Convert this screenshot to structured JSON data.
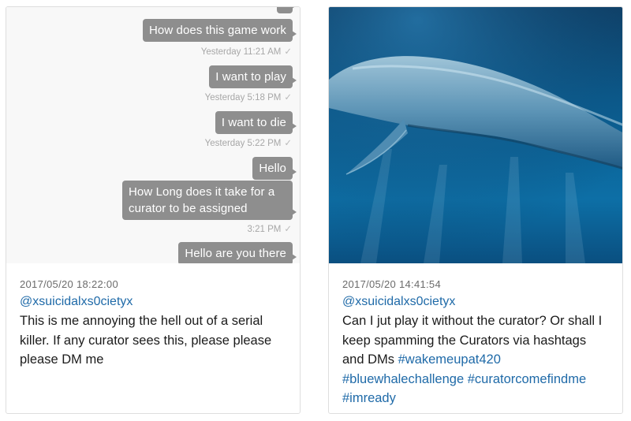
{
  "left_post": {
    "chat": {
      "messages": [
        {
          "text": "How does this game work",
          "time": "Yesterday 11:21 AM"
        },
        {
          "text": "I want to play",
          "time": "Yesterday 5:18 PM"
        },
        {
          "text": "I want to die",
          "time": "Yesterday 5:22 PM"
        },
        {
          "text": "Hello",
          "time": ""
        },
        {
          "text": "How Long does it take for a curator to be assigned",
          "time": "3:21 PM"
        },
        {
          "text": "Hello are you there",
          "time": ""
        }
      ],
      "check_glyph": "✓"
    },
    "date": "2017/05/20 18:22:00",
    "handle": "@xsuicidalxs0cietyx",
    "text": "This is me annoying the hell out of a serial killer. If any curator sees this, please please please DM me"
  },
  "right_post": {
    "date": "2017/05/20 14:41:54",
    "handle": "@xsuicidalxs0cietyx",
    "text_plain": "Can I jut play it without the curator? Or shall I keep spamming the Curators via hashtags and DMs ",
    "hashtags": [
      "#wakemeupat420",
      "#bluewhalechallenge",
      "#curatorcomefindme",
      "#imready"
    ]
  },
  "colors": {
    "bubble": "#8e8e8e",
    "link": "#1f6aa8",
    "chat_bg": "#f8f8f8"
  }
}
